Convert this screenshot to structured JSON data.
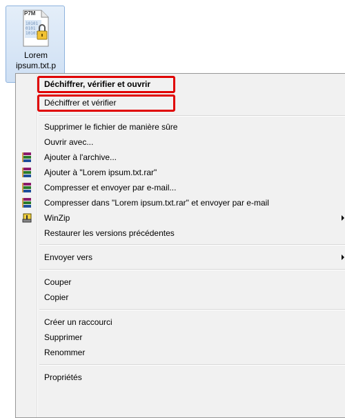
{
  "file": {
    "badge": "P7M",
    "name_line1": "Lorem",
    "name_line2": "ipsum.txt.p"
  },
  "menu": {
    "decrypt_verify_open": "Déchiffrer, vérifier et ouvrir",
    "decrypt_verify": "Déchiffrer et vérifier",
    "secure_delete": "Supprimer le fichier de manière sûre",
    "open_with": "Ouvrir avec...",
    "add_to_archive": "Ajouter à l'archive...",
    "add_to_rar": "Ajouter à \"Lorem ipsum.txt.rar\"",
    "compress_email": "Compresser et envoyer par e-mail...",
    "compress_rar_email": "Compresser dans \"Lorem ipsum.txt.rar\" et envoyer par e-mail",
    "winzip": "WinZip",
    "restore_versions": "Restaurer les versions précédentes",
    "send_to": "Envoyer vers",
    "cut": "Couper",
    "copy": "Copier",
    "create_shortcut": "Créer un raccourci",
    "delete": "Supprimer",
    "rename": "Renommer",
    "properties": "Propriétés"
  },
  "colors": {
    "highlight": "#e00000",
    "menu_bg": "#f1f1f1"
  }
}
